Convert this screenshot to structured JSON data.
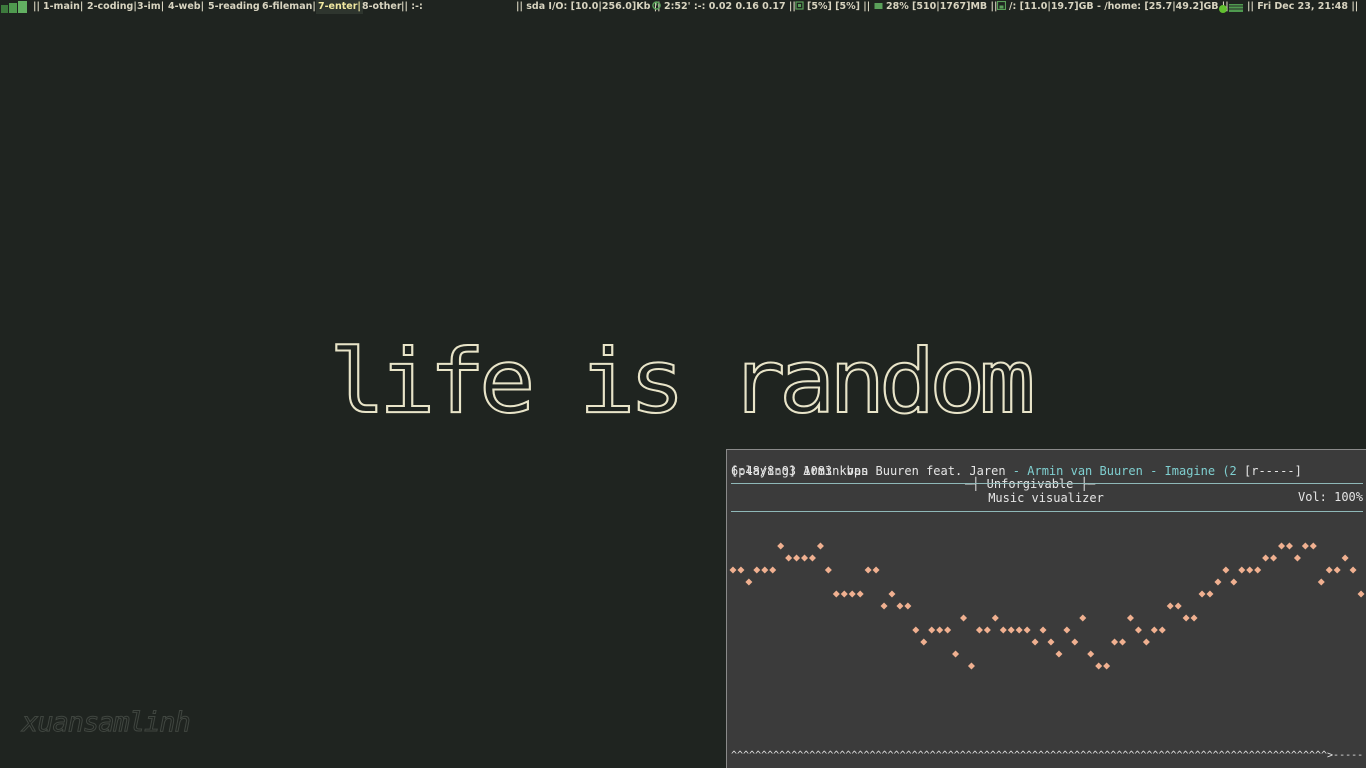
{
  "statusbar": {
    "sep_open": "||",
    "workspaces": [
      {
        "label": "1-main|",
        "active": false
      },
      {
        "label": "2-coding|",
        "active": false
      },
      {
        "label": "3-im|",
        "active": false
      },
      {
        "label": "4-web|",
        "active": false
      },
      {
        "label": "5-reading",
        "active": false
      },
      {
        "label": "6-fileman|",
        "active": false
      },
      {
        "label": "7-enter|",
        "active": true
      },
      {
        "label": "8-other",
        "active": false
      }
    ],
    "layout_marker": "|| :-:",
    "disk_io": "|| sda I/O: [10.0|256.0]Kb ||",
    "uptime_load": "2:52' :-: 0.02 0.16 0.17 ||",
    "cpu": "[5%] [5%] ||",
    "memory": "28% [510|1767]MB ||",
    "filesystem": "/: [11.0|19.7]GB - /home: [25.7|49.2]GB ||",
    "datetime": "|| Fri Dec 23, 21:48 ||",
    "colors": {
      "text": "#d8d4c0",
      "active": "#f0e8a0",
      "icon": "#5aa05a"
    }
  },
  "wallpaper": {
    "headline": "life is random",
    "signature": "xuansamlinh",
    "color": "#e8e4c8"
  },
  "player": {
    "time": "6:48/8:03 1083 kbps",
    "title": "─┤ Unforgivable ├─",
    "volume": "Vol: 100%",
    "state": "[playing]",
    "artist": "Armin van Buuren feat. Jaren",
    "dash": " - ",
    "album": "Armin van Buuren - Imagine (2",
    "flags": "[r-----]",
    "screen_title": "Music visualizer",
    "progress_text": "^^^^^^^^^^^^^^^^^^^^^^^^^^^^^^^^^^^^^^^^^^^^^^^^^^^^^^^^^^^^^^^^^^^^^^^^^^^^^^^^^^^^^^^^^^^^^^^^^^^>-----------",
    "visualizer_values": [
      13,
      13,
      12,
      13,
      13,
      13,
      15,
      14,
      14,
      14,
      14,
      15,
      13,
      11,
      11,
      11,
      11,
      13,
      13,
      10,
      11,
      10,
      10,
      8,
      7,
      8,
      8,
      8,
      6,
      9,
      5,
      8,
      8,
      9,
      8,
      8,
      8,
      8,
      7,
      8,
      7,
      6,
      8,
      7,
      9,
      6,
      5,
      5,
      7,
      7,
      9,
      8,
      7,
      8,
      8,
      10,
      10,
      9,
      9,
      11,
      11,
      12,
      13,
      12,
      13,
      13,
      13,
      14,
      14,
      15,
      15,
      14,
      15,
      15,
      12,
      13,
      13,
      14,
      13,
      11
    ],
    "visualizer_max": 16,
    "colors": {
      "bg": "#3b3b3b",
      "text": "#e6e6e6",
      "accent": "#7fcfd0",
      "dots": "#f0b090"
    }
  }
}
